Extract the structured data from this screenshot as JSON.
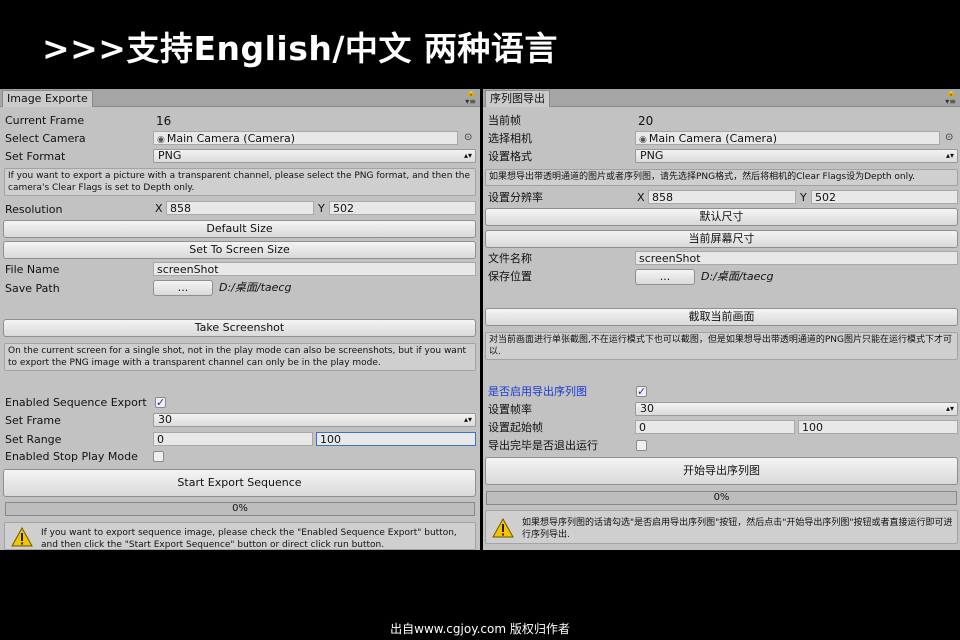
{
  "headline": ">>>支持English/中文 两种语言",
  "credit": "出自www.cgjoy.com 版权归作者",
  "icons": {
    "panel_menu": "lock-and-menu-icon",
    "camera": "camera-icon",
    "target": "object-picker-icon",
    "warning": "warning-triangle-icon",
    "dropdown": "dropdown-arrow-icon"
  },
  "colors": {
    "progress_fill": "#6a9ad8",
    "focus_border": "#3b73c8",
    "warning_icon": "#f5c400"
  },
  "en": {
    "tab": "Image Exporte",
    "current_frame_label": "Current Frame",
    "current_frame_value": "16",
    "camera_label": "Select Camera",
    "camera_value": "Main Camera (Camera)",
    "format_label": "Set Format",
    "format_value": "PNG",
    "format_help": "If you want to export a picture with a transparent channel, please select the PNG format, and then the camera's Clear Flags  is set to Depth only.",
    "resolution_label": "Resolution",
    "x_label": "X",
    "x_value": "858",
    "y_label": "Y",
    "y_value": "502",
    "default_size": "Default Size",
    "screen_size": "Set To Screen Size",
    "file_name_label": "File Name",
    "file_name_value": "screenShot",
    "save_path_label": "Save Path",
    "browse": "...",
    "save_path_value": "D:/桌面/taecg",
    "take_screenshot": "Take Screenshot",
    "screenshot_help": "On the current screen for a single shot, not in the play mode can also be screenshots, but if you want to export the PNG image with a transparent channel can only be in the play mode.",
    "sequence_label": "Enabled Sequence Export",
    "sequence_checked": true,
    "set_frame_label": "Set Frame",
    "set_frame_value": "30",
    "set_range_label": "Set Range",
    "range_start": "0",
    "range_end": "100",
    "stop_play_label": "Enabled Stop Play Mode",
    "stop_play_checked": false,
    "start_export": "Start Export Sequence",
    "progress": 0,
    "progress_text": "0%",
    "warning": "If you want to export sequence image, please check the \"Enabled Sequence Export\" button, and then click the \"Start Export Sequence\" button or direct click run button."
  },
  "zh": {
    "tab": "序列图导出",
    "current_frame_label": "当前帧",
    "current_frame_value": "20",
    "camera_label": "选择相机",
    "camera_value": "Main Camera (Camera)",
    "format_label": "设置格式",
    "format_value": "PNG",
    "format_help": "如果想导出带透明通道的图片或者序列图，请先选择PNG格式，然后将相机的Clear Flags设为Depth only.",
    "resolution_label": "设置分辨率",
    "x_label": "X",
    "x_value": "858",
    "y_label": "Y",
    "y_value": "502",
    "default_size": "默认尺寸",
    "screen_size": "当前屏幕尺寸",
    "file_name_label": "文件名称",
    "file_name_value": "screenShot",
    "save_path_label": "保存位置",
    "browse": "...",
    "save_path_value": "D:/桌面/taecg",
    "take_screenshot": "截取当前画面",
    "screenshot_help": "对当前画面进行单张截图,不在运行模式下也可以截图，但是如果想导出带透明通道的PNG图片只能在运行模式下才可以.",
    "sequence_label": "是否启用导出序列图",
    "sequence_checked": true,
    "set_frame_label": "设置帧率",
    "set_frame_value": "30",
    "set_range_label": "设置起始帧",
    "range_start": "0",
    "range_end": "100",
    "stop_play_label": "导出完毕是否退出运行",
    "stop_play_checked": false,
    "start_export": "开始导出序列图",
    "progress": 0,
    "progress_text": "0%",
    "warning": "如果想导序列图的话请勾选\"是否启用导出序列图\"按钮，然后点击\"开始导出序列图\"按钮或者直接运行即可进行序列导出."
  }
}
